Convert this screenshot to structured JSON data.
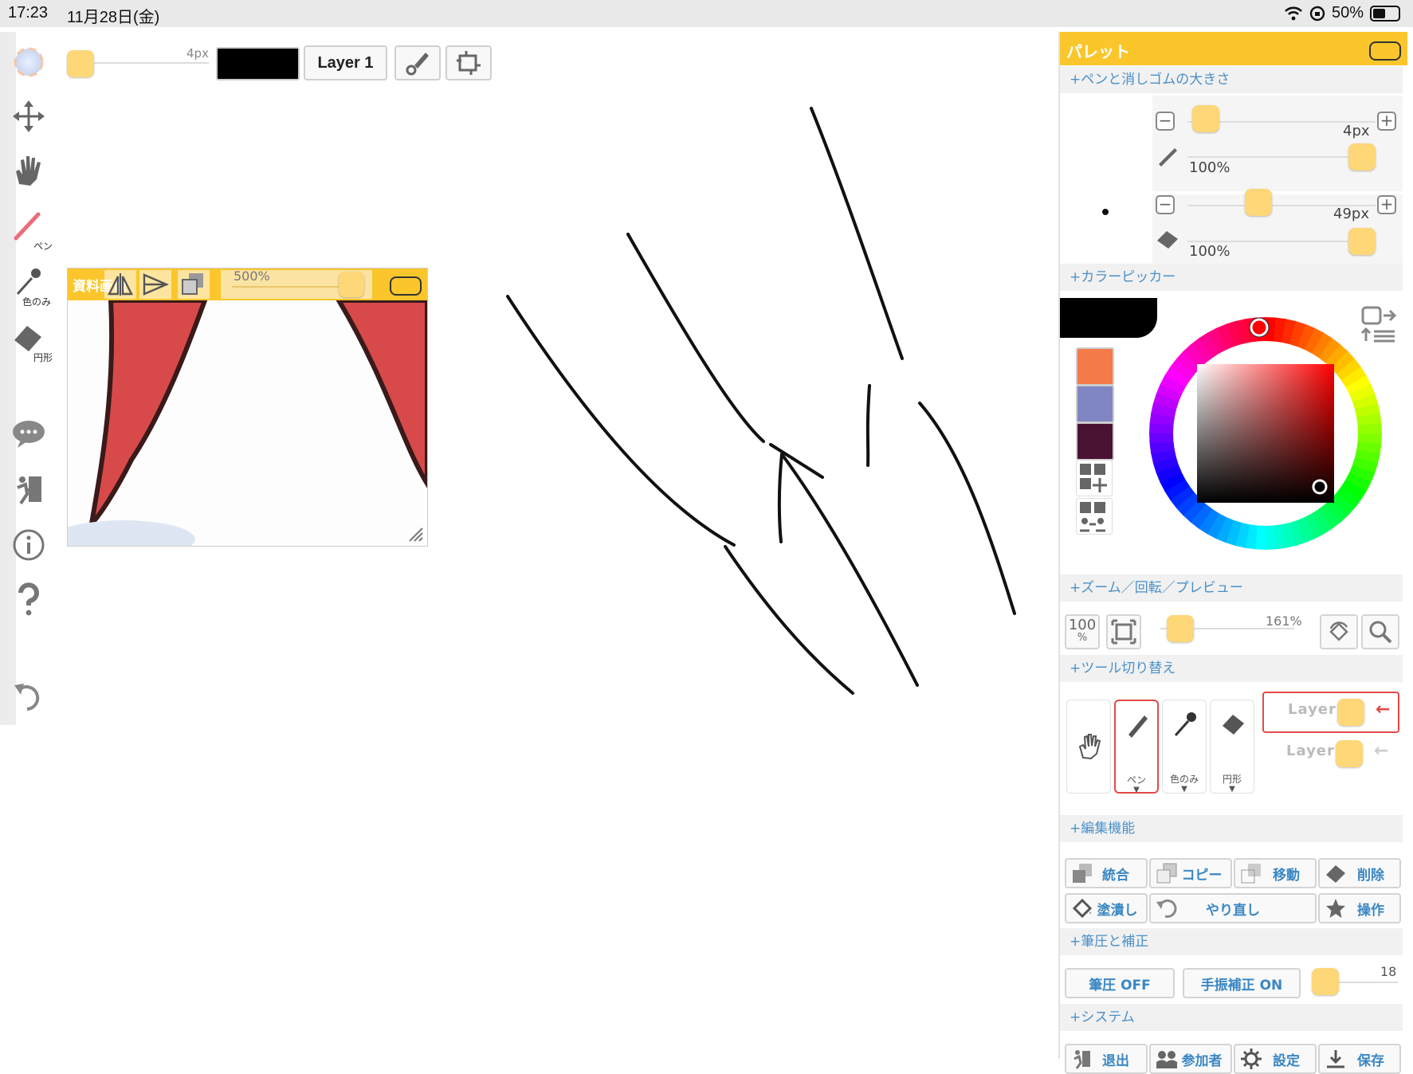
{
  "status_bar": {
    "time": "17:23",
    "date": "11月28日(金)",
    "battery": "50%"
  },
  "left_toolbar": {
    "items": [
      {
        "name": "color-icon",
        "label": ""
      },
      {
        "name": "move-icon",
        "label": ""
      },
      {
        "name": "hand-icon",
        "label": ""
      },
      {
        "name": "pen-icon",
        "label": "ペン"
      },
      {
        "name": "eyedropper-icon",
        "label": "色のみ"
      },
      {
        "name": "eraser-icon",
        "label": "円形"
      },
      {
        "name": "chat-icon",
        "label": ""
      },
      {
        "name": "exit-icon",
        "label": ""
      },
      {
        "name": "info-icon",
        "label": ""
      },
      {
        "name": "help-icon",
        "label": ""
      },
      {
        "name": "undo-icon",
        "label": ""
      }
    ]
  },
  "top_toolbar": {
    "pen_size_label": "4px",
    "pen_size_fraction": 0.0,
    "layer_label": "Layer 1",
    "current_color": "#000000"
  },
  "reference_window": {
    "title": "資料画像",
    "zoom_label": "500%",
    "zoom_fraction": 1.0
  },
  "palette": {
    "title": "パレット",
    "sections": {
      "size": "+ペンと消しゴムの大きさ",
      "color_picker": "+カラーピッカー",
      "zoom": "+ズーム／回転／プレビュー",
      "tool_switch": "+ツール切り替え",
      "edit": "+編集機能",
      "pressure": "+筆圧と補正",
      "system": "+システム"
    },
    "pen": {
      "size_label": "4px",
      "opacity_label": "100%",
      "size_fraction": 0.02,
      "opacity_fraction": 1.0
    },
    "eraser": {
      "size_label": "49px",
      "opacity_label": "100%",
      "size_fraction": 0.35,
      "opacity_fraction": 1.0
    },
    "color_picker": {
      "current_color": "#000000",
      "swatches": [
        "#f47a4a",
        "#7f86c2",
        "#4a1232"
      ],
      "hue_color": "#ff0000"
    },
    "zoom": {
      "reset_label_top": "100",
      "reset_label_bottom": "%",
      "zoom_label": "161%",
      "zoom_fraction": 0.05
    },
    "tools": [
      {
        "name": "hand",
        "label": ""
      },
      {
        "name": "pen",
        "label": "ペン"
      },
      {
        "name": "eyedropper",
        "label": "色のみ"
      },
      {
        "name": "eraser",
        "label": "円形"
      }
    ],
    "layers": [
      {
        "label": "Layer1",
        "active": true
      },
      {
        "label": "Layer2",
        "active": false
      }
    ],
    "edit_buttons": {
      "merge": "統合",
      "copy": "コピー",
      "move": "移動",
      "delete": "削除",
      "fill": "塗潰し",
      "redo": "やり直し",
      "operation": "操作"
    },
    "pressure": {
      "pressure_label": "筆圧 OFF",
      "stabilizer_label": "手振補正 ON",
      "stabilizer_value": "18",
      "stabilizer_fraction": 0.0
    },
    "system_buttons": {
      "exit": "退出",
      "participants": "参加者",
      "settings": "設定",
      "save": "保存"
    }
  }
}
